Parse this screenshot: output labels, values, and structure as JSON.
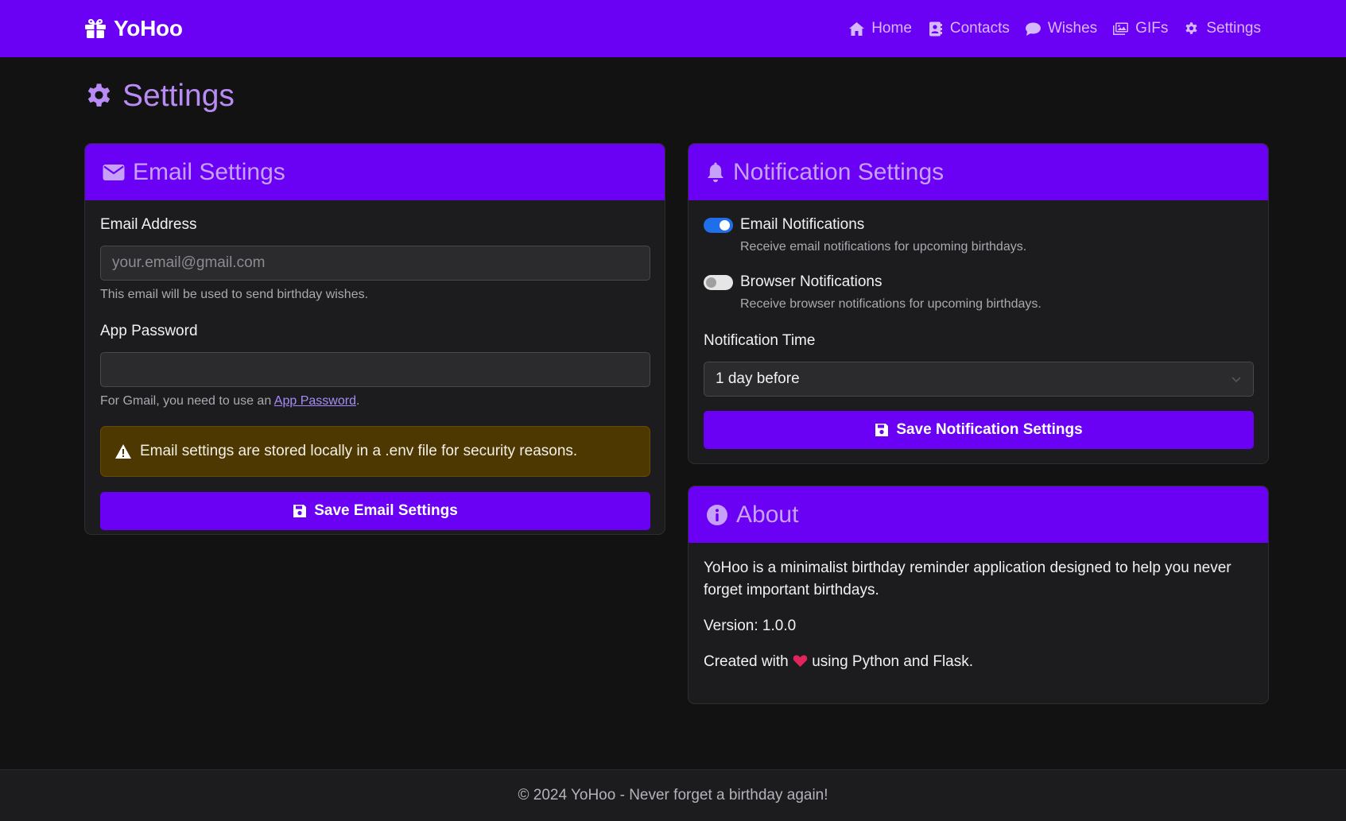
{
  "brand": {
    "name": "YoHoo"
  },
  "nav": [
    {
      "label": "Home",
      "icon": "home-icon"
    },
    {
      "label": "Contacts",
      "icon": "address-book-icon"
    },
    {
      "label": "Wishes",
      "icon": "comment-icon"
    },
    {
      "label": "GIFs",
      "icon": "images-icon"
    },
    {
      "label": "Settings",
      "icon": "gear-icon"
    }
  ],
  "page": {
    "title": "Settings"
  },
  "email_settings": {
    "title": "Email Settings",
    "email_label": "Email Address",
    "email_placeholder": "your.email@gmail.com",
    "email_value": "",
    "email_help": "This email will be used to send birthday wishes.",
    "password_label": "App Password",
    "password_value": "",
    "password_help_prefix": "For Gmail, you need to use an",
    "password_help_link": "App Password",
    "password_help_suffix": ".",
    "alert": "Email settings are stored locally in a .env file for security reasons.",
    "save_label": "Save Email Settings"
  },
  "notification_settings": {
    "title": "Notification Settings",
    "email_toggle": {
      "label": "Email Notifications",
      "description": "Receive email notifications for upcoming birthdays.",
      "checked": true
    },
    "browser_toggle": {
      "label": "Browser Notifications",
      "description": "Receive browser notifications for upcoming birthdays.",
      "checked": false
    },
    "time_label": "Notification Time",
    "time_value": "1 day before",
    "save_label": "Save Notification Settings"
  },
  "about": {
    "title": "About",
    "description": "YoHoo is a minimalist birthday reminder application designed to help you never forget important birthdays.",
    "version": "Version: 1.0.0",
    "created_prefix": "Created with",
    "created_suffix": "using Python and Flask."
  },
  "footer": {
    "text": "© 2024 YoHoo - Never forget a birthday again!"
  },
  "colors": {
    "accent": "#6a00f4",
    "title": "#b98cf5",
    "background": "#121212",
    "card": "#1c1c1e",
    "heart": "#e0245e",
    "alert": "#4c3800"
  }
}
